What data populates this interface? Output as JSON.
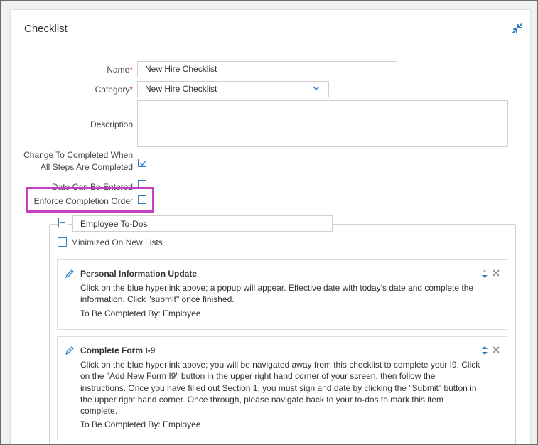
{
  "panel": {
    "title": "Checklist"
  },
  "form": {
    "name_label": "Name",
    "name_value": "New Hire Checklist",
    "category_label": "Category",
    "category_value": "New Hire Checklist",
    "required_mark": "*",
    "description_label": "Description",
    "description_value": "",
    "change_completed_label_line1": "Change To Completed When",
    "change_completed_label_line2": "All Steps Are Completed",
    "change_completed_checked": true,
    "date_entered_label": "Date Can Be Entered",
    "date_entered_checked": false,
    "enforce_order_label": "Enforce Completion Order",
    "enforce_order_checked": false
  },
  "group": {
    "name": "Employee To-Dos",
    "minimized_label": "Minimized On New Lists",
    "minimized_checked": false
  },
  "tasks": [
    {
      "title": "Personal Information Update",
      "body": "Click on the blue hyperlink above; a popup will appear. Effective date with today's date and complete the information. Click \"submit\" once finished.",
      "completed_by": "To Be Completed By: Employee"
    },
    {
      "title": "Complete Form I-9",
      "body": "Click on the blue hyperlink above; you will be navigated away from this checklist to complete your I9. Click on the \"Add New Form I9\" button in the upper right hand corner of your screen, then follow the instructions. Once you have filled out Section 1, you must sign and date by clicking the \"Submit\" button in the upper right hand corner. Once through, please navigate back to your to-dos to mark this item complete.",
      "completed_by": "To Be Completed By: Employee"
    }
  ],
  "icons": {
    "collapse": "collapse-arrows-icon",
    "chevron": "chevron-down-icon",
    "edit": "pencil-icon",
    "sort": "sort-arrows-icon",
    "close": "close-icon"
  },
  "colors": {
    "accent": "#2f7fc1",
    "highlight": "#c440c4",
    "required": "#c0392b"
  }
}
